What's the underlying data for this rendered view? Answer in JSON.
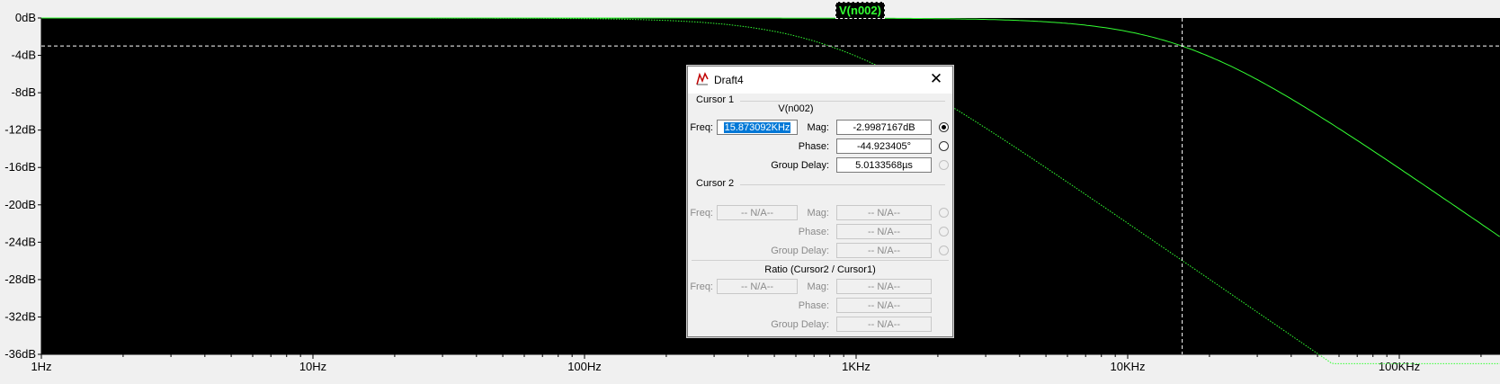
{
  "plot": {
    "y_tick_labels": [
      "0dB",
      "-4dB",
      "-8dB",
      "-12dB",
      "-16dB",
      "-20dB",
      "-24dB",
      "-28dB",
      "-32dB",
      "-36dB"
    ],
    "x_tick_labels": [
      "1Hz",
      "10Hz",
      "100Hz",
      "1KHz",
      "10KHz",
      "100KHz"
    ],
    "trace_label": "V(n002)",
    "trace_color": "#33ff33",
    "background_color": "#000000",
    "cursor_freq_hz": 15873.092,
    "cursor_mag_db": -2.9987167
  },
  "chart_data": {
    "type": "line",
    "x_scale": "log",
    "x_range_hz": [
      1,
      300000
    ],
    "ylim": [
      -36,
      0
    ],
    "series": [
      {
        "name": "V(n002)",
        "style": "solid",
        "corner_freq_hz": 15873
      },
      {
        "name": "",
        "style": "dotted",
        "corner_freq_hz": 800
      }
    ]
  },
  "dialog": {
    "title": "Draft4",
    "close_glyph": "✕",
    "cursor1": {
      "group_label": "Cursor 1",
      "trace_name": "V(n002)",
      "freq_label": "Freq:",
      "freq_value": "15.873092KHz",
      "mag_label": "Mag:",
      "mag_value": "-2.9987167dB",
      "phase_label": "Phase:",
      "phase_value": "-44.923405°",
      "gd_label": "Group Delay:",
      "gd_value": "5.0133568µs"
    },
    "cursor2": {
      "group_label": "Cursor 2",
      "freq_label": "Freq:",
      "freq_value": "-- N/A--",
      "mag_label": "Mag:",
      "mag_value": "-- N/A--",
      "phase_label": "Phase:",
      "phase_value": "-- N/A--",
      "gd_label": "Group Delay:",
      "gd_value": "-- N/A--"
    },
    "ratio": {
      "group_label": "Ratio (Cursor2 / Cursor1)",
      "freq_label": "Freq:",
      "freq_value": "-- N/A--",
      "mag_label": "Mag:",
      "mag_value": "-- N/A--",
      "phase_label": "Phase:",
      "phase_value": "-- N/A--",
      "gd_label": "Group Delay:",
      "gd_value": "-- N/A--"
    }
  }
}
